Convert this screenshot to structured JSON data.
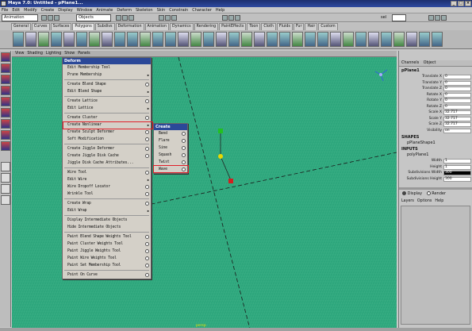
{
  "window": {
    "title": "Maya 7.0: Untitled  -  pPlane1...",
    "controls": [
      "_",
      "□",
      "×"
    ]
  },
  "menubar": [
    "File",
    "Edit",
    "Modify",
    "Create",
    "Display",
    "Window",
    "Animate",
    "Deform",
    "Skeleton",
    "Skin",
    "Constrain",
    "Character",
    "Help"
  ],
  "statusline": {
    "mode": "Animation",
    "object_field": "Objects",
    "sel_label": "sel"
  },
  "shelf_tabs": [
    "General",
    "Curves",
    "Surfaces",
    "Polygons",
    "Subdivs",
    "Deformation",
    "Animation",
    "Dynamics",
    "Rendering",
    "PaintEffects",
    "Toon",
    "Cloth",
    "Fluids",
    "Fur",
    "Hair",
    "Custom"
  ],
  "shelf_active": "Polygons",
  "panel_menu": [
    "View",
    "Shading",
    "Lighting",
    "Show",
    "Panels"
  ],
  "deform_menu": {
    "title": "Deform",
    "items": [
      {
        "label": "Edit Membership Tool",
        "opt": false,
        "sub": false
      },
      {
        "label": "Prune Membership",
        "opt": false,
        "sub": true
      },
      {
        "sep": true
      },
      {
        "label": "Create Blend Shape",
        "opt": true,
        "sub": false
      },
      {
        "label": "Edit Blend Shape",
        "opt": false,
        "sub": true
      },
      {
        "sep": true
      },
      {
        "label": "Create Lattice",
        "opt": true,
        "sub": false
      },
      {
        "label": "Edit Lattice",
        "opt": false,
        "sub": true
      },
      {
        "sep": true
      },
      {
        "label": "Create Cluster",
        "opt": true,
        "sub": false
      },
      {
        "label": "Create Nonlinear",
        "opt": false,
        "sub": true
      },
      {
        "label": "Create Sculpt Deformer",
        "opt": true,
        "sub": false
      },
      {
        "label": "Soft Modification",
        "opt": true,
        "sub": false
      },
      {
        "sep": true
      },
      {
        "label": "Create Jiggle Deformer",
        "opt": true,
        "sub": false
      },
      {
        "label": "Create Jiggle Disk Cache",
        "opt": true,
        "sub": false
      },
      {
        "label": "Jiggle Disk Cache Attributes...",
        "opt": false,
        "sub": false
      },
      {
        "sep": true
      },
      {
        "label": "Wire Tool",
        "opt": true,
        "sub": false
      },
      {
        "label": "Edit Wire",
        "opt": false,
        "sub": true
      },
      {
        "label": "Wire Dropoff Locator",
        "opt": true,
        "sub": false
      },
      {
        "label": "Wrinkle Tool",
        "opt": true,
        "sub": false
      },
      {
        "sep": true
      },
      {
        "label": "Create Wrap",
        "opt": true,
        "sub": false
      },
      {
        "label": "Edit Wrap",
        "opt": false,
        "sub": true
      },
      {
        "sep": true
      },
      {
        "label": "Display Intermediate Objects",
        "opt": false,
        "sub": false
      },
      {
        "label": "Hide Intermediate Objects",
        "opt": false,
        "sub": false
      },
      {
        "sep": true
      },
      {
        "label": "Paint Blend Shape Weights Tool",
        "opt": true,
        "sub": false
      },
      {
        "label": "Paint Cluster Weights Tool",
        "opt": true,
        "sub": false
      },
      {
        "label": "Paint Jiggle Weights Tool",
        "opt": true,
        "sub": false
      },
      {
        "label": "Paint Wire Weights Tool",
        "opt": true,
        "sub": false
      },
      {
        "label": "Paint Set Membership Tool",
        "opt": true,
        "sub": false
      },
      {
        "sep": true
      },
      {
        "label": "Point On Curve",
        "opt": true,
        "sub": false
      }
    ]
  },
  "create_submenu": {
    "title": "Create",
    "items": [
      "Bend",
      "Flare",
      "Sine",
      "Squash",
      "Twist",
      "Wave"
    ]
  },
  "channel_box": {
    "header": [
      "Channels",
      "Object"
    ],
    "object": "pPlane1",
    "channels": [
      {
        "name": "Translate X",
        "value": "0"
      },
      {
        "name": "Translate Y",
        "value": "0"
      },
      {
        "name": "Translate Z",
        "value": "0"
      },
      {
        "name": "Rotate X",
        "value": "0"
      },
      {
        "name": "Rotate Y",
        "value": "0"
      },
      {
        "name": "Rotate Z",
        "value": "0"
      },
      {
        "name": "Scale X",
        "value": "32.717"
      },
      {
        "name": "Scale Y",
        "value": "32.717"
      },
      {
        "name": "Scale Z",
        "value": "32.717"
      },
      {
        "name": "Visibility",
        "value": "on"
      }
    ],
    "shapes_label": "SHAPES",
    "shape_name": "pPlaneShape1",
    "inputs_label": "INPUTS",
    "input_name": "polyPlane1",
    "inputs": [
      {
        "name": "Width",
        "value": "1"
      },
      {
        "name": "Height",
        "value": "1"
      },
      {
        "name": "Subdivisions Width",
        "value": "300"
      },
      {
        "name": "Subdivisions Height",
        "value": "300"
      }
    ],
    "layer_display": "Display",
    "layer_render": "Render",
    "layer_menu": [
      "Layers",
      "Options",
      "Help"
    ]
  },
  "viewport_label": "persp"
}
